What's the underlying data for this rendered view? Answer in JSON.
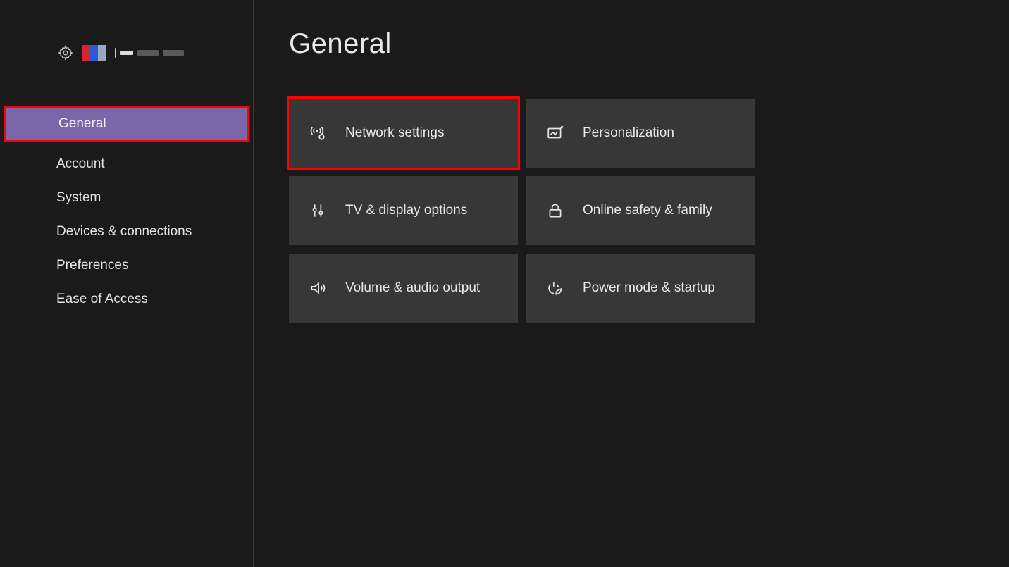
{
  "main": {
    "title": "General"
  },
  "sidebar": {
    "items": [
      {
        "label": "General",
        "selected": true
      },
      {
        "label": "Account"
      },
      {
        "label": "System"
      },
      {
        "label": "Devices & connections"
      },
      {
        "label": "Preferences"
      },
      {
        "label": "Ease of Access"
      }
    ]
  },
  "tiles": [
    {
      "label": "Network settings",
      "icon": "network-icon",
      "highlighted": true
    },
    {
      "label": "Personalization",
      "icon": "personalization-icon"
    },
    {
      "label": "TV & display options",
      "icon": "tv-display-icon"
    },
    {
      "label": "Online safety & family",
      "icon": "lock-icon"
    },
    {
      "label": "Volume & audio output",
      "icon": "volume-icon"
    },
    {
      "label": "Power mode & startup",
      "icon": "power-eco-icon"
    }
  ]
}
